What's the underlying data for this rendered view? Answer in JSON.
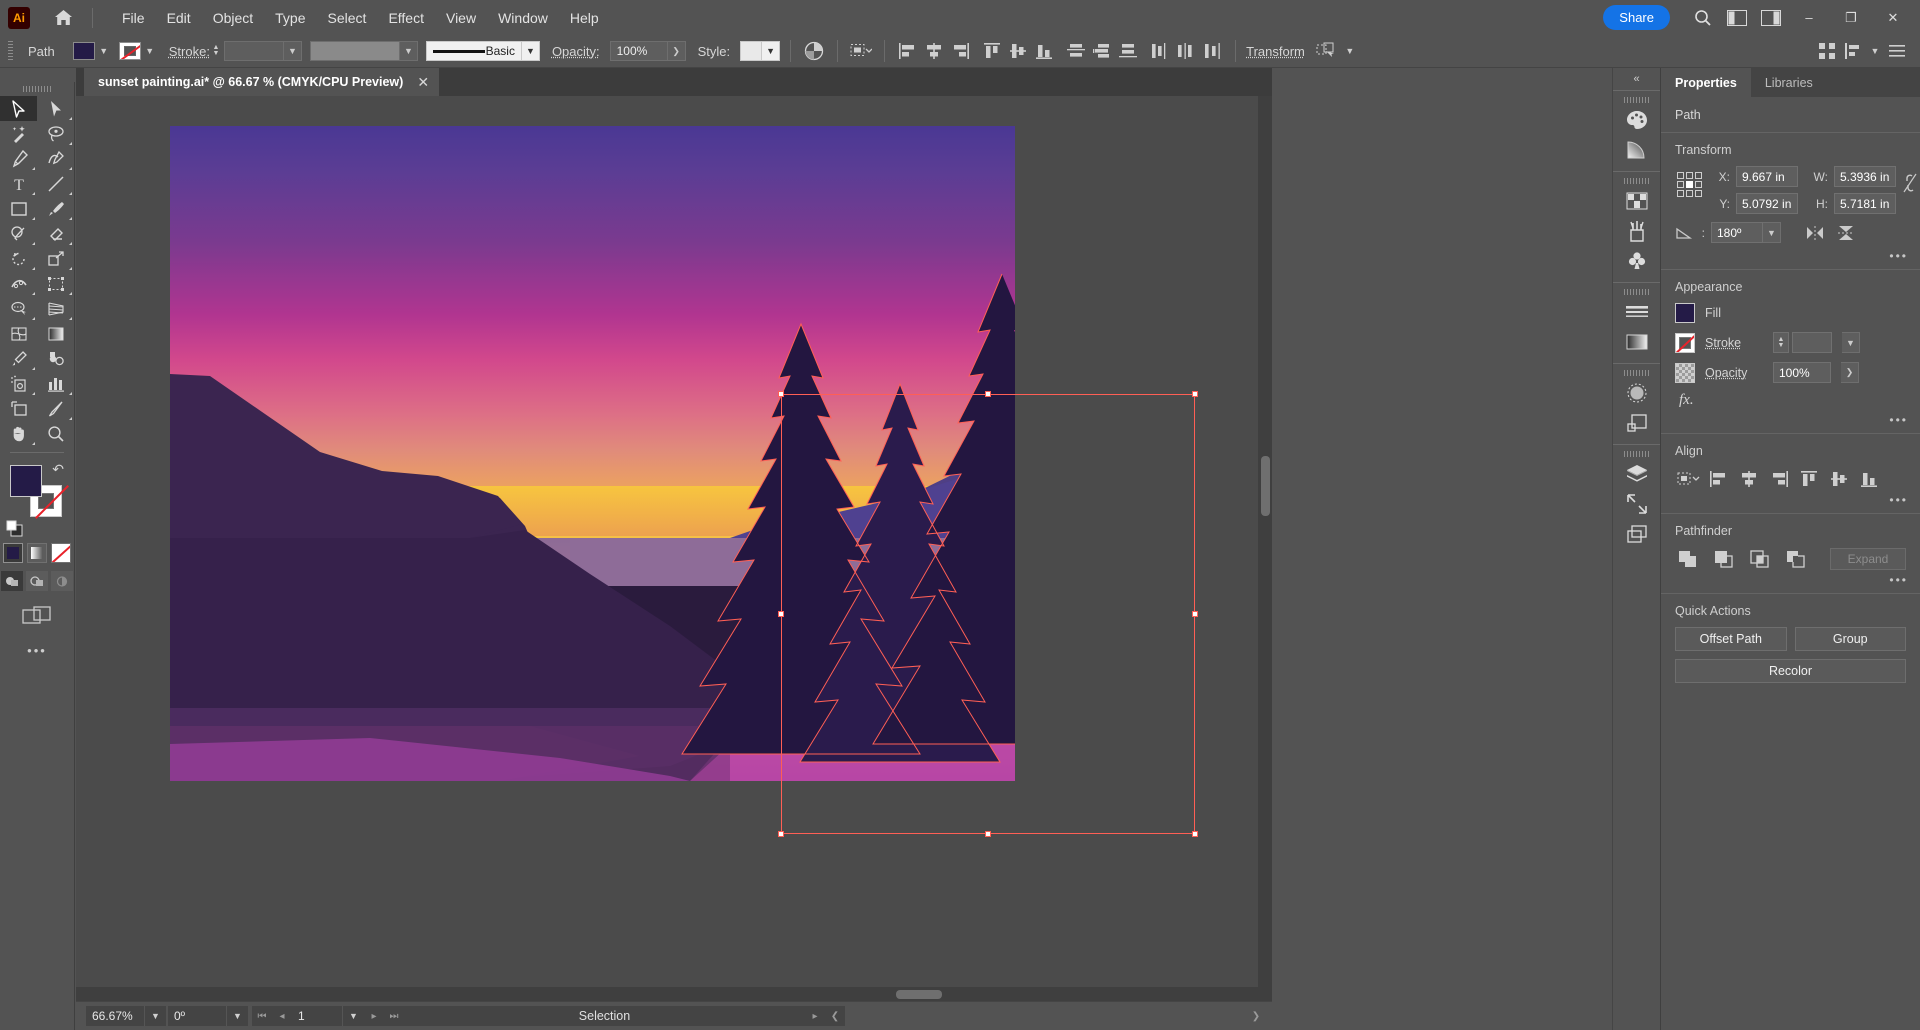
{
  "app": {
    "logo_text": "Ai",
    "home_icon": "home-icon"
  },
  "menubar": {
    "items": [
      "File",
      "Edit",
      "Object",
      "Type",
      "Select",
      "Effect",
      "View",
      "Window",
      "Help"
    ],
    "share_label": "Share",
    "search_icon": "search-icon",
    "arrange_icon": "arrange-documents-icon",
    "workspace_icon": "workspace-switcher-icon",
    "minimize": "–",
    "maximize": "❐",
    "close": "✕"
  },
  "controlbar": {
    "object_type": "Path",
    "fill_color": "#241b47",
    "stroke_color": "none",
    "stroke_label": "Stroke:",
    "stroke_weight": "",
    "stroke_variable_width": "",
    "brush_definition": "Basic",
    "opacity_label": "Opacity:",
    "opacity_value": "100%",
    "style_label": "Style:",
    "style_swatch": "#e9e9e9",
    "transform_label": "Transform",
    "recolor_icon": "recolor-artwork-icon",
    "select_similar_icon": "select-similar-objects-icon",
    "isolate_icon": "isolation-mode-icon",
    "align_icons": [
      "align-left-icon",
      "align-horizontal-center-icon",
      "align-right-icon",
      "align-top-icon",
      "align-vertical-center-icon",
      "align-bottom-icon",
      "distribute-vertical-top-icon",
      "distribute-vertical-center-icon",
      "distribute-vertical-bottom-icon",
      "distribute-horizontal-left-icon",
      "distribute-horizontal-center-icon",
      "distribute-horizontal-right-icon"
    ],
    "overflow_icon": "panel-menu-icon",
    "arrange_icon": "arrange-icon",
    "align_panel_icon": "align-panel-icon"
  },
  "toolbar": {
    "tools": [
      {
        "name": "selection-tool",
        "active": true
      },
      {
        "name": "direct-selection-tool",
        "active": false
      },
      {
        "name": "magic-wand-tool",
        "active": false
      },
      {
        "name": "lasso-tool",
        "active": false
      },
      {
        "name": "pen-tool",
        "active": false
      },
      {
        "name": "curvature-tool",
        "active": false
      },
      {
        "name": "type-tool",
        "active": false
      },
      {
        "name": "line-segment-tool",
        "active": false
      },
      {
        "name": "rectangle-tool",
        "active": false
      },
      {
        "name": "paintbrush-tool",
        "active": false
      },
      {
        "name": "shaper-tool",
        "active": false
      },
      {
        "name": "eraser-tool",
        "active": false
      },
      {
        "name": "rotate-tool",
        "active": false
      },
      {
        "name": "scale-tool",
        "active": false
      },
      {
        "name": "width-tool",
        "active": false
      },
      {
        "name": "free-transform-tool",
        "active": false
      },
      {
        "name": "shape-builder-tool",
        "active": false
      },
      {
        "name": "perspective-grid-tool",
        "active": false
      },
      {
        "name": "mesh-tool",
        "active": false
      },
      {
        "name": "gradient-tool",
        "active": false
      },
      {
        "name": "eyedropper-tool",
        "active": false
      },
      {
        "name": "blend-tool",
        "active": false
      },
      {
        "name": "symbol-sprayer-tool",
        "active": false
      },
      {
        "name": "column-graph-tool",
        "active": false
      },
      {
        "name": "artboard-tool",
        "active": false
      },
      {
        "name": "slice-tool",
        "active": false
      },
      {
        "name": "hand-tool",
        "active": false
      },
      {
        "name": "zoom-tool",
        "active": false
      }
    ],
    "fill_color": "#241b47",
    "stroke_color": "#ffffff",
    "stroke_none": true,
    "swap_icon": "swap-fill-stroke-icon",
    "default_icon": "default-fill-stroke-icon",
    "paint_modes": [
      "color-swatch-mode",
      "gradient-mode",
      "none-mode"
    ],
    "draw_modes": [
      "draw-normal-mode",
      "draw-behind-mode",
      "draw-inside-mode"
    ],
    "screen_mode_icon": "change-screen-mode-icon",
    "more_tools": "•••"
  },
  "document": {
    "tab_title": "sunset painting.ai* @ 66.67 % (CMYK/CPU Preview)",
    "close_icon": "close-tab-icon"
  },
  "statusbar": {
    "zoom_value": "66.67%",
    "rotation_value": "0º",
    "artboard_number": "1",
    "tool_status": "Selection",
    "first_icon": "first-artboard-icon",
    "prev_icon": "previous-artboard-icon",
    "next_icon": "next-artboard-icon",
    "last_icon": "last-artboard-icon",
    "play_icon": "status-menu-icon",
    "collapse_icon": "collapse-status-icon",
    "expand_icon": "expand-status-icon"
  },
  "icondock": {
    "collapse_icon": "collapse-panels-icon",
    "groups": [
      [
        "color-panel-icon",
        "gradient-panel-icon"
      ],
      [
        "swatches-panel-icon",
        "brushes-panel-icon",
        "symbols-panel-icon"
      ],
      [
        "stroke-panel-icon",
        "gradient-bar-panel-icon"
      ],
      [
        "transparency-panel-icon",
        "appearance-panel-icon"
      ],
      [
        "layers-panel-icon",
        "links-panel-icon",
        "artboards-panel-icon"
      ]
    ]
  },
  "properties": {
    "tabs": [
      {
        "label": "Properties",
        "active": true
      },
      {
        "label": "Libraries",
        "active": false
      }
    ],
    "object_label": "Path",
    "transform": {
      "title": "Transform",
      "reference_point": "center",
      "x_label": "X:",
      "x_value": "9.667 in",
      "y_label": "Y:",
      "y_value": "5.0792 in",
      "w_label": "W:",
      "w_value": "5.3936 in",
      "h_label": "H:",
      "h_value": "5.7181 in",
      "angle_label": "⊿:",
      "angle_value": "180º",
      "link_icon": "constrain-proportions-unlinked-icon",
      "flip_h_icon": "flip-horizontal-icon",
      "flip_v_icon": "flip-vertical-icon",
      "more_icon": "more-options-icon"
    },
    "appearance": {
      "title": "Appearance",
      "fill_label": "Fill",
      "fill_color": "#241b47",
      "stroke_label": "Stroke",
      "stroke_color": "none",
      "stroke_weight": "",
      "opacity_label": "Opacity",
      "opacity_value": "100%",
      "fx_label": "fx.",
      "more_icon": "more-options-icon"
    },
    "align": {
      "title": "Align",
      "buttons": [
        "align-to-selection-icon",
        "align-left-icon",
        "align-horizontal-center-icon",
        "align-right-icon",
        "align-top-icon",
        "align-vertical-center-icon",
        "align-bottom-icon"
      ],
      "more_icon": "more-options-icon"
    },
    "pathfinder": {
      "title": "Pathfinder",
      "buttons": [
        "unite-icon",
        "minus-front-icon",
        "intersect-icon",
        "exclude-icon"
      ],
      "expand_label": "Expand",
      "more_icon": "more-options-icon"
    },
    "quick_actions": {
      "title": "Quick Actions",
      "buttons": [
        "Offset Path",
        "Group",
        "Recolor"
      ]
    }
  },
  "artwork": {
    "title": "sunset painting",
    "description": "Flat vector sunset landscape with layered mountains, a lake, and three pine trees in silhouette",
    "colors": {
      "sky_top": "#4a3894",
      "sky_mid": "#b13590",
      "sky_low": "#e08b7b",
      "sun_glow": "#f7c53f",
      "far_ridge": "#5b4a8f",
      "dark_mountain": "#3a2550",
      "tree_silhouette": "#231640",
      "water_light": "#8c6490",
      "water_pink": "#c44ba8",
      "water_deep": "#5c2f63",
      "foreground": "#3b1f4a",
      "selection": "#ff5f55"
    }
  }
}
